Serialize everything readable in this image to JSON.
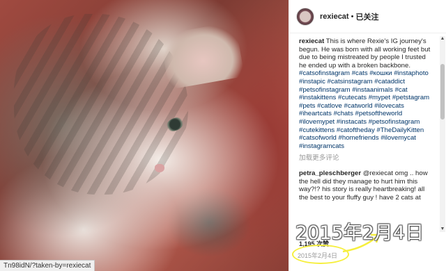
{
  "header": {
    "username": "rexiecat",
    "separator": "•",
    "follow_status": "已关注"
  },
  "caption": {
    "username": "rexiecat",
    "text": "This is where Rexie's IG journey's begun. He was born with all working feet but due to being mistreated by people I trusted he ended up with a broken backbone.",
    "hashtags": "#catsofinstagram #cats #кошки #instaphoto #instapic #catsinstagram #cataddict #petsofinstagram #instaanimals #cat #instakittens #cutecats #mypet #petstagram #pets #catlove #catworld #ilovecats #iheartcats #chats #petsoftheworld #ilovemypet #instacats #petsofinstagram #cutekittens #catoftheday #TheDailyKitten #catsofworld #homefriends #ilovemycat #instagramcats"
  },
  "load_more": "加载更多评论",
  "comment": {
    "username": "petra_pleschberger",
    "text": "@rexiecat omg .. how the hell did they manage to hurt him this way?!? his story is really heartbreaking! all the best to your fluffy guy ! have 2 cats at"
  },
  "likes": "1,195 次赞",
  "date": "2015年2月4日",
  "overlay_date": "2015年2月4日",
  "status_bar_url": "Tn98idN/?taken-by=rexiecat",
  "colors": {
    "highlight_ring": "#f6ef3d",
    "hashtag": "#003569",
    "muted": "#999999"
  }
}
